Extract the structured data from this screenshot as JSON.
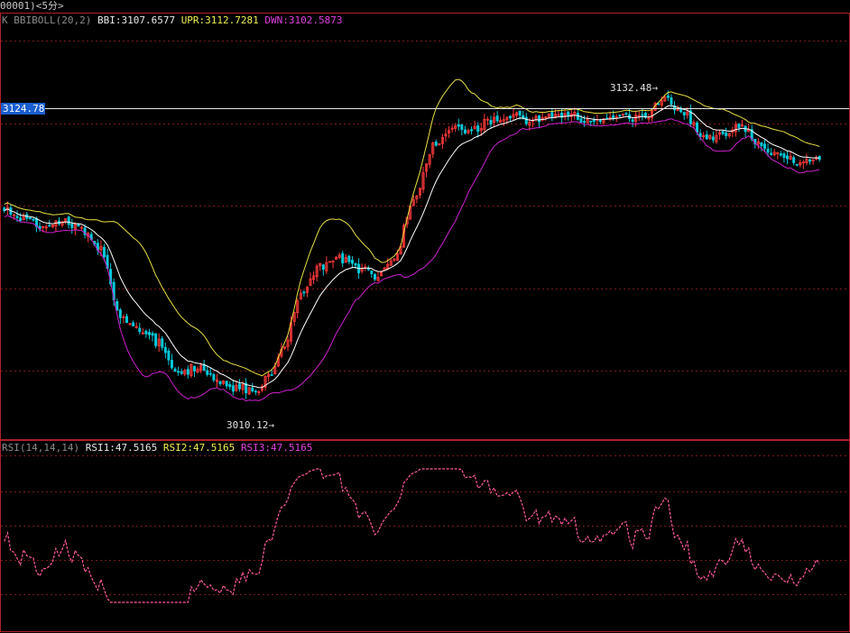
{
  "titlebar": {
    "text": "00001)<5分>"
  },
  "main_legend": {
    "indicator": "K  BBIBOLL(20,2)",
    "bbi_label": "BBI:3107.6577",
    "upr_label": "UPR:3112.7281",
    "dwn_label": "DWN:3102.5873"
  },
  "rsi_legend": {
    "indicator": "RSI(14,14,14)",
    "rsi1_label": "RSI1:47.5165",
    "rsi2_label": "RSI2:47.5165",
    "rsi3_label": "RSI3:47.5165"
  },
  "price_tag": {
    "text": "3124.78",
    "value": 3124.78
  },
  "annotations": {
    "high_text": "3132.48→",
    "low_text": "3010.12→"
  },
  "colors": {
    "up": "#ff3a3a",
    "down": "#00c8d8",
    "bbi": "#ffffff",
    "upr": "#e8e040",
    "dwn": "#d020d0",
    "rsi": "#ff5aa0",
    "grid": "#7a1a1a",
    "frame": "#b02020"
  },
  "chart_data": [
    {
      "type": "candlestick",
      "indicator": "BBIBOLL(20,2)",
      "ylim": [
        3006,
        3152
      ],
      "waypoints": [
        {
          "i": 0,
          "close": 3086
        },
        {
          "i": 6,
          "close": 3083
        },
        {
          "i": 12,
          "close": 3080
        },
        {
          "i": 18,
          "close": 3082
        },
        {
          "i": 24,
          "close": 3079
        },
        {
          "i": 30,
          "close": 3071
        },
        {
          "i": 36,
          "close": 3046
        },
        {
          "i": 42,
          "close": 3041
        },
        {
          "i": 48,
          "close": 3036
        },
        {
          "i": 54,
          "close": 3024
        },
        {
          "i": 60,
          "close": 3027
        },
        {
          "i": 66,
          "close": 3022
        },
        {
          "i": 72,
          "close": 3019
        },
        {
          "i": 78,
          "close": 3018
        },
        {
          "i": 82,
          "close": 3024
        },
        {
          "i": 87,
          "close": 3036
        },
        {
          "i": 92,
          "close": 3055
        },
        {
          "i": 98,
          "close": 3065
        },
        {
          "i": 104,
          "close": 3068
        },
        {
          "i": 110,
          "close": 3064
        },
        {
          "i": 116,
          "close": 3061
        },
        {
          "i": 121,
          "close": 3068
        },
        {
          "i": 127,
          "close": 3090
        },
        {
          "i": 133,
          "close": 3110
        },
        {
          "i": 139,
          "close": 3118
        },
        {
          "i": 145,
          "close": 3116
        },
        {
          "i": 151,
          "close": 3120
        },
        {
          "i": 157,
          "close": 3122
        },
        {
          "i": 163,
          "close": 3120
        },
        {
          "i": 169,
          "close": 3122
        },
        {
          "i": 175,
          "close": 3123
        },
        {
          "i": 181,
          "close": 3120
        },
        {
          "i": 187,
          "close": 3121
        },
        {
          "i": 193,
          "close": 3121
        },
        {
          "i": 199,
          "close": 3122
        },
        {
          "i": 205,
          "close": 3128
        },
        {
          "i": 211,
          "close": 3123
        },
        {
          "i": 217,
          "close": 3113
        },
        {
          "i": 223,
          "close": 3114
        },
        {
          "i": 229,
          "close": 3118
        },
        {
          "i": 235,
          "close": 3110
        },
        {
          "i": 241,
          "close": 3107
        },
        {
          "i": 247,
          "close": 3104
        },
        {
          "i": 253,
          "close": 3106
        }
      ],
      "high_annotation": 3132.48,
      "low_annotation": 3010.12,
      "reference_line": 3124.78,
      "series": [
        {
          "name": "BBI",
          "last": 3107.6577
        },
        {
          "name": "UPR",
          "last": 3112.7281
        },
        {
          "name": "DWN",
          "last": 3102.5873
        }
      ]
    },
    {
      "type": "line",
      "indicator": "RSI(14,14,14)",
      "ylim": [
        18,
        88
      ],
      "series": [
        {
          "name": "RSI1",
          "last": 47.5165
        },
        {
          "name": "RSI2",
          "last": 47.5165
        },
        {
          "name": "RSI3",
          "last": 47.5165
        }
      ]
    }
  ]
}
